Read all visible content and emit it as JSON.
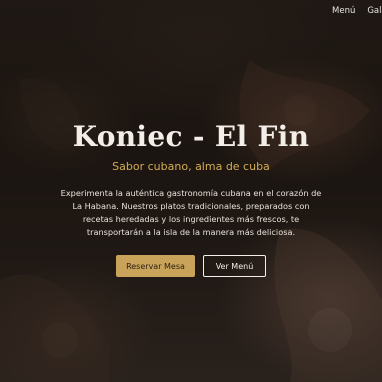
{
  "nav": {
    "items": [
      "Menú",
      "Galer"
    ]
  },
  "hero": {
    "title": "Koniec - El Fin",
    "subtitle": "Sabor cubano, alma de cuba",
    "description": "Experimenta la auténtica gastronomía cubana en el corazón de La Habana. Nuestros platos tradicionales, preparados con recetas heredadas y los ingredientes más frescos, te transportarán a la isla de la manera más deliciosa.",
    "primary_button": "Reservar Mesa",
    "secondary_button": "Ver Menú"
  },
  "colors": {
    "accent": "#c9a35a",
    "subtitle": "#d4ad53",
    "text": "#f3eee7"
  }
}
